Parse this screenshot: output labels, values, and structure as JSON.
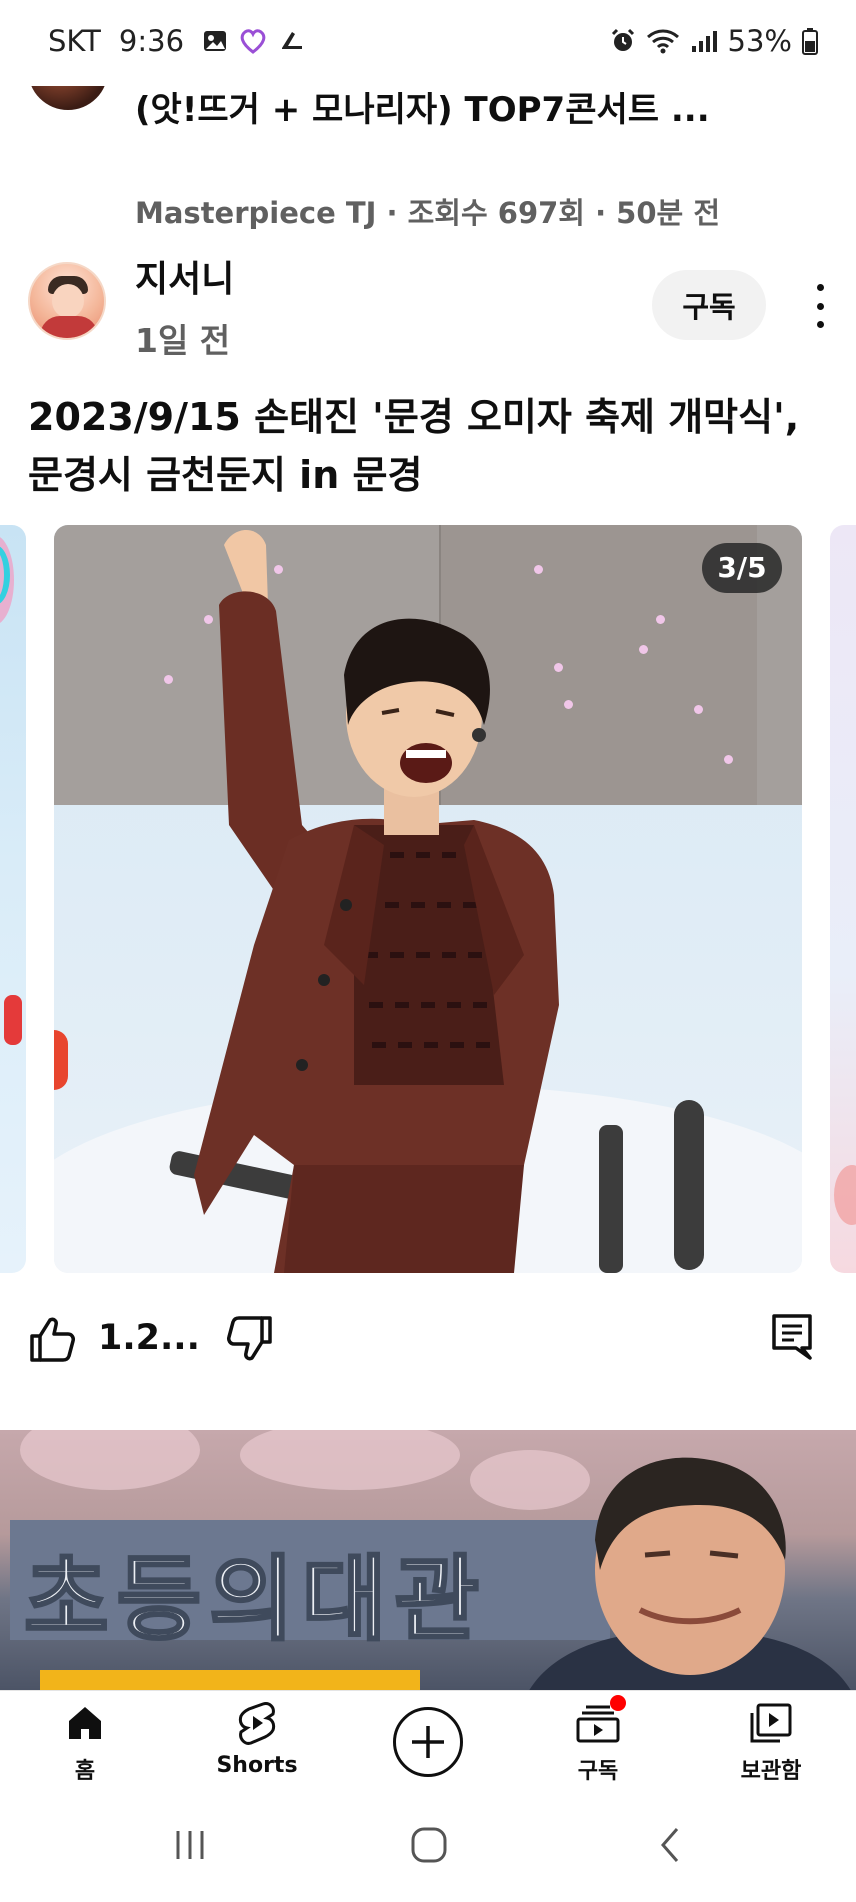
{
  "status_bar": {
    "carrier": "SKT",
    "time": "9:36",
    "battery": "53%",
    "icons": [
      "gallery-icon",
      "heart-app-icon",
      "skate-icon",
      "alarm-icon",
      "wifi-icon",
      "signal-icon",
      "battery-icon"
    ]
  },
  "prev_video": {
    "title": "(앗!뜨거 + 모나리자) TOP7콘서트 ...",
    "meta": "Masterpiece TJ · 조회수 697회 · 50분 전"
  },
  "post": {
    "channel": "지서니",
    "time": "1일 전",
    "subscribe_label": "구독",
    "text": "2023/9/15 손태진 '문경 오미자 축제 개막식', 문경시 금천둔지 in 문경",
    "image_counter": "3/5",
    "like_count": "1.2..."
  },
  "next_video": {
    "sign_text": "초등의대관"
  },
  "bottom_nav": {
    "items": [
      {
        "label": "홈",
        "icon": "home-icon"
      },
      {
        "label": "Shorts",
        "icon": "shorts-icon"
      },
      {
        "label": "",
        "icon": "create-icon"
      },
      {
        "label": "구독",
        "icon": "subscriptions-icon"
      },
      {
        "label": "보관함",
        "icon": "library-icon"
      }
    ]
  },
  "colors": {
    "accent_red": "#ff0000",
    "text_primary": "#0f0f0f",
    "text_secondary": "#606060",
    "chip_bg": "#f2f2f2"
  }
}
